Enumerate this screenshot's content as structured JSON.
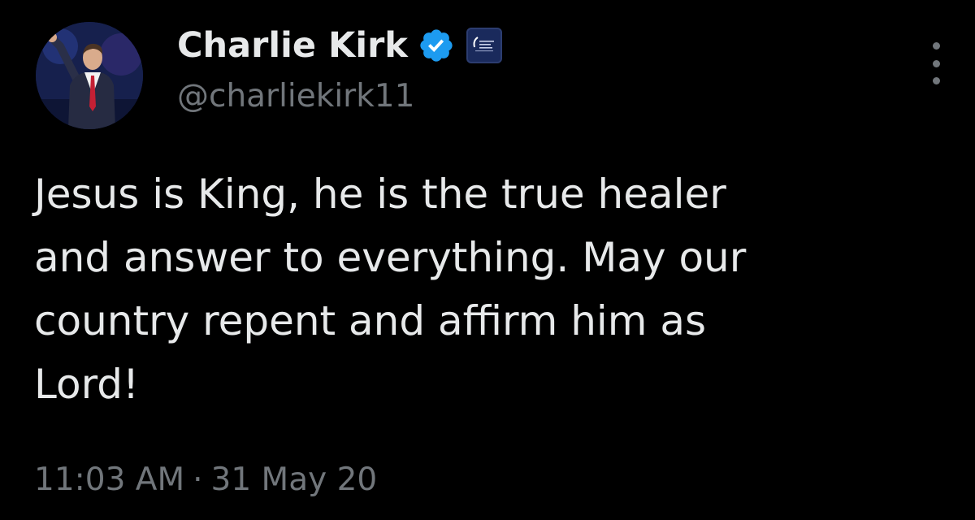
{
  "tweet": {
    "author": {
      "display_name": "Charlie Kirk",
      "handle": "@charliekirk11",
      "verified_icon": "verified-badge-icon",
      "affiliation_icon": "organization-logo-icon"
    },
    "text_lines": [
      "Jesus is King, he is the true healer",
      "and answer to everything. May our",
      "country repent and affirm him as",
      "Lord!"
    ],
    "time": "11:03 AM",
    "separator": "·",
    "date": "31 May 20",
    "more_icon": "more-options-icon"
  },
  "colors": {
    "background": "#000000",
    "primary_text": "#e7e9ea",
    "secondary_text": "#71767b",
    "verified_blue": "#1d9bf0"
  }
}
